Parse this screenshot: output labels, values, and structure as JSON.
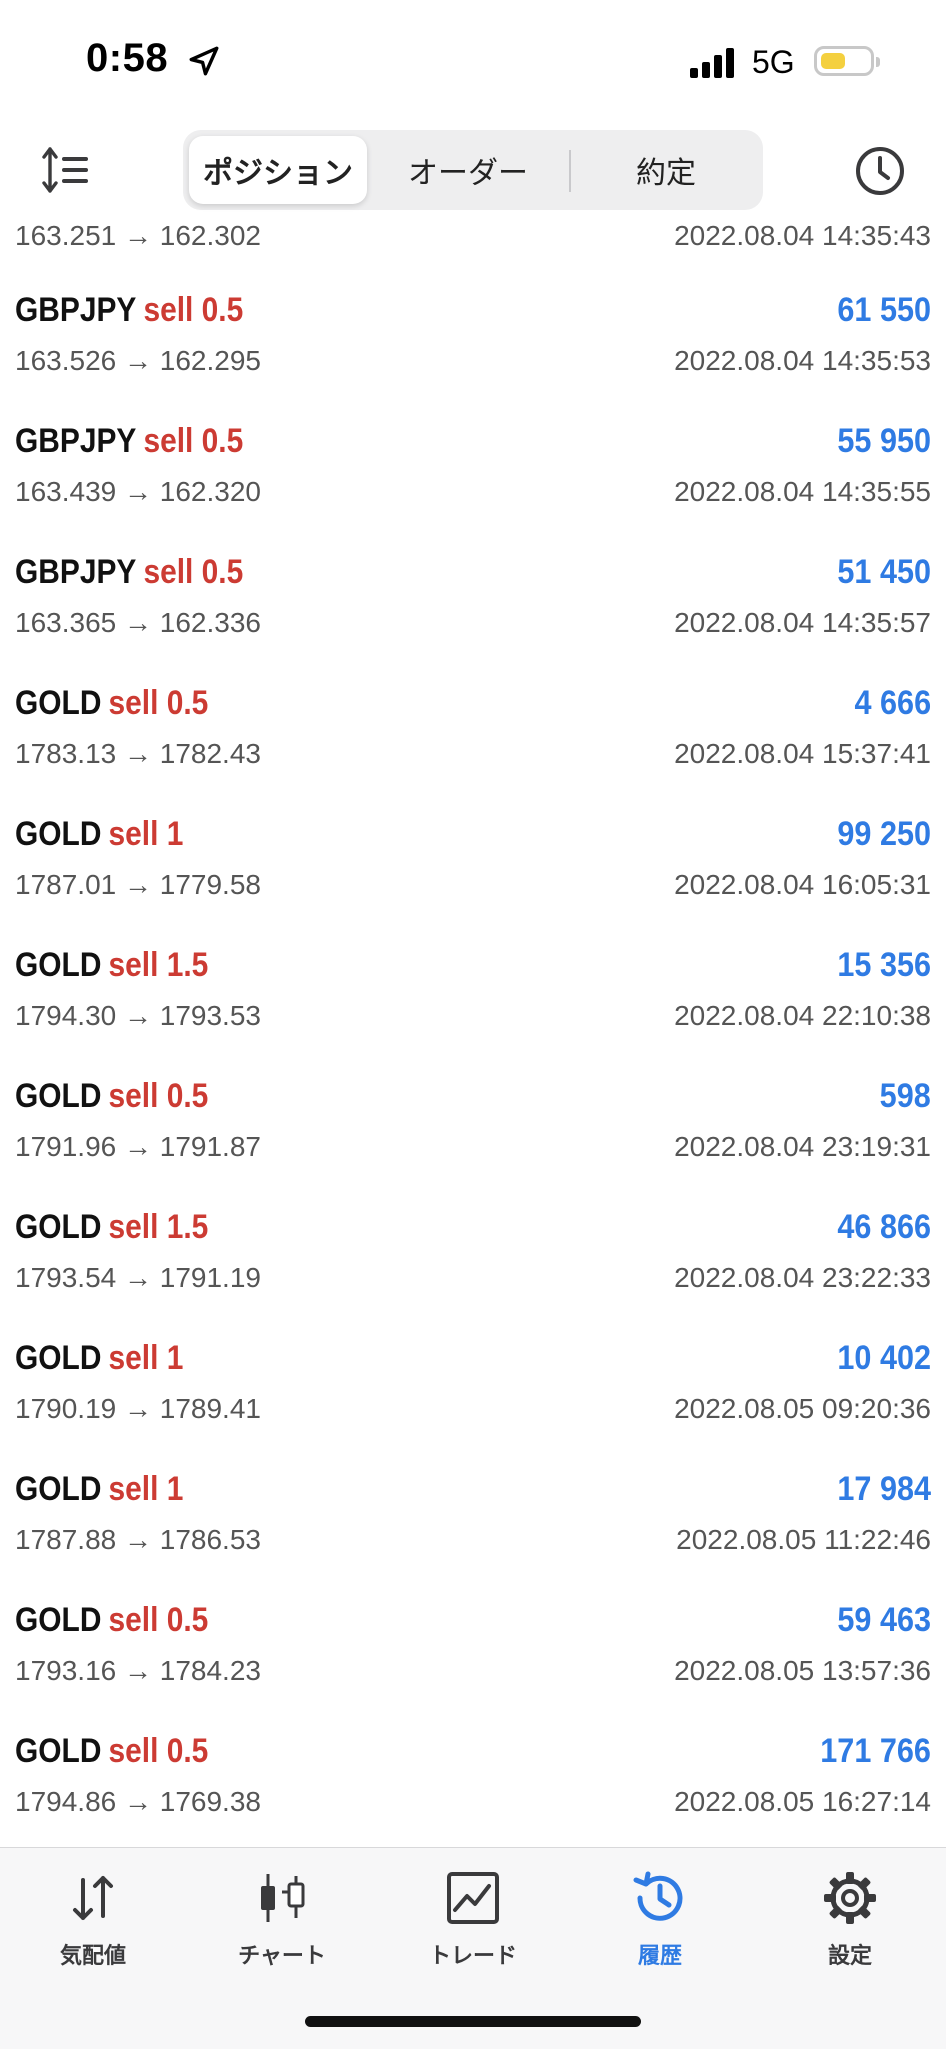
{
  "status": {
    "time": "0:58",
    "network": "5G",
    "battery_level": 0.55
  },
  "tabs": [
    {
      "label": "ポジション",
      "active": true
    },
    {
      "label": "オーダー",
      "active": false
    },
    {
      "label": "約定",
      "active": false
    }
  ],
  "partial_row": {
    "prices": "163.251 → 162.302",
    "date": "2022.08.04 14:35:43"
  },
  "trades": [
    {
      "symbol": "GBPJPY",
      "side": "sell 0.5",
      "profit": "61 550",
      "prices": "163.526 → 162.295",
      "date": "2022.08.04 14:35:53"
    },
    {
      "symbol": "GBPJPY",
      "side": "sell 0.5",
      "profit": "55 950",
      "prices": "163.439 → 162.320",
      "date": "2022.08.04 14:35:55"
    },
    {
      "symbol": "GBPJPY",
      "side": "sell 0.5",
      "profit": "51 450",
      "prices": "163.365 → 162.336",
      "date": "2022.08.04 14:35:57"
    },
    {
      "symbol": "GOLD",
      "side": "sell 0.5",
      "profit": "4 666",
      "prices": "1783.13 → 1782.43",
      "date": "2022.08.04 15:37:41"
    },
    {
      "symbol": "GOLD",
      "side": "sell 1",
      "profit": "99 250",
      "prices": "1787.01 → 1779.58",
      "date": "2022.08.04 16:05:31"
    },
    {
      "symbol": "GOLD",
      "side": "sell 1.5",
      "profit": "15 356",
      "prices": "1794.30 → 1793.53",
      "date": "2022.08.04 22:10:38"
    },
    {
      "symbol": "GOLD",
      "side": "sell 0.5",
      "profit": "598",
      "prices": "1791.96 → 1791.87",
      "date": "2022.08.04 23:19:31"
    },
    {
      "symbol": "GOLD",
      "side": "sell 1.5",
      "profit": "46 866",
      "prices": "1793.54 → 1791.19",
      "date": "2022.08.04 23:22:33"
    },
    {
      "symbol": "GOLD",
      "side": "sell 1",
      "profit": "10 402",
      "prices": "1790.19 → 1789.41",
      "date": "2022.08.05 09:20:36"
    },
    {
      "symbol": "GOLD",
      "side": "sell 1",
      "profit": "17 984",
      "prices": "1787.88 → 1786.53",
      "date": "2022.08.05 11:22:46"
    },
    {
      "symbol": "GOLD",
      "side": "sell 0.5",
      "profit": "59 463",
      "prices": "1793.16 → 1784.23",
      "date": "2022.08.05 13:57:36"
    },
    {
      "symbol": "GOLD",
      "side": "sell 0.5",
      "profit": "171 766",
      "prices": "1794.86 → 1769.38",
      "date": "2022.08.05 16:27:14"
    }
  ],
  "bottom_tabs": [
    {
      "label": "気配値",
      "icon": "quotes-arrows-icon",
      "active": false
    },
    {
      "label": "チャート",
      "icon": "candlestick-icon",
      "active": false
    },
    {
      "label": "トレード",
      "icon": "trade-chart-icon",
      "active": false
    },
    {
      "label": "履歴",
      "icon": "history-icon",
      "active": true
    },
    {
      "label": "設定",
      "icon": "gear-icon",
      "active": false
    }
  ],
  "colors": {
    "sell": "#cc3b33",
    "profit": "#2f7be3",
    "active_tab": "#2f7be3"
  }
}
